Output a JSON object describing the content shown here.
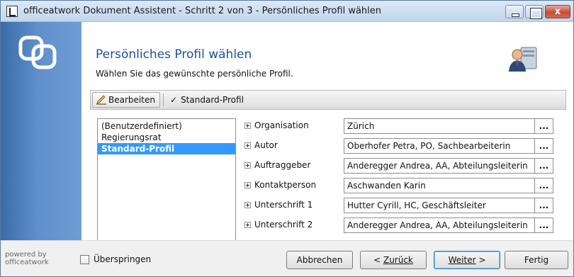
{
  "window": {
    "title": "officeatwork Dokument Assistent - Schritt 2 von 3 - Persönliches Profil wählen",
    "close_glyph": "x"
  },
  "header": {
    "title": "Persönliches Profil wählen",
    "subtitle": "Wählen Sie das gewünschte persönliche Profil."
  },
  "toolbar": {
    "edit_label": "Bearbeiten",
    "profile_label": "Standard-Profil",
    "check_glyph": "✓"
  },
  "profiles": {
    "items": [
      "(Benutzerdefiniert)",
      "Regierungsrat",
      "Standard-Profil"
    ],
    "selected": "Standard-Profil"
  },
  "properties": {
    "rows": [
      {
        "label": "Organisation",
        "value": "Zürich"
      },
      {
        "label": "Autor",
        "value": "Oberhofer Petra, PO, Sachbearbeiterin"
      },
      {
        "label": "Auftraggeber",
        "value": "Anderegger Andrea, AA, Abteilungsleiterin"
      },
      {
        "label": "Kontaktperson",
        "value": "Aschwanden Karin"
      },
      {
        "label": "Unterschrift 1",
        "value": "Hutter Cyrill, HC, Geschäftsleiter"
      },
      {
        "label": "Unterschrift 2",
        "value": "Anderegger Andrea, AA, Abteilungsleiterin"
      }
    ],
    "dots": "..."
  },
  "footer": {
    "powered_line1": "powered by",
    "powered_line2": "officeatwork",
    "skip_label": "Überspringen",
    "cancel": "Abbrechen",
    "back_prefix": "< ",
    "back_label": "Zurück",
    "next_label": "Weiter",
    "next_suffix": " >",
    "finish": "Fertig"
  },
  "colors": {
    "title_blue": "#1f4f9a",
    "selection": "#3399ff",
    "sidebar": "#5f8fcb"
  }
}
